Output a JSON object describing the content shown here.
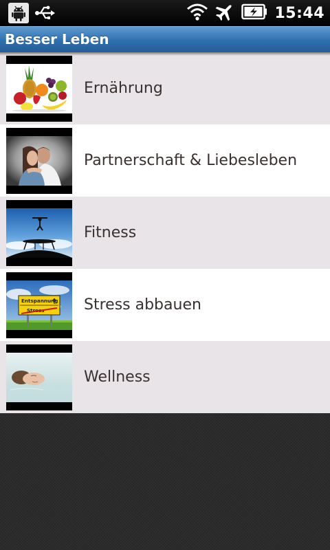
{
  "status_bar": {
    "time": "15:44",
    "icons": [
      "android-debug-icon",
      "usb-icon",
      "wifi-icon",
      "airplane-mode-icon",
      "battery-charging-icon"
    ]
  },
  "app_bar": {
    "title": "Besser Leben",
    "color": "#2e6fae"
  },
  "list": {
    "items": [
      {
        "label": "Ernährung",
        "image": "fruits-photo"
      },
      {
        "label": "Partnerschaft & Liebesleben",
        "image": "couple-photo"
      },
      {
        "label": "Fitness",
        "image": "trampoline-photo"
      },
      {
        "label": "Stress abbauen",
        "image": "road-sign-photo"
      },
      {
        "label": "Wellness",
        "image": "bath-photo"
      }
    ]
  },
  "thumbnail_texts": {
    "sign_top": "Entspannung",
    "sign_bottom": "Stress"
  }
}
